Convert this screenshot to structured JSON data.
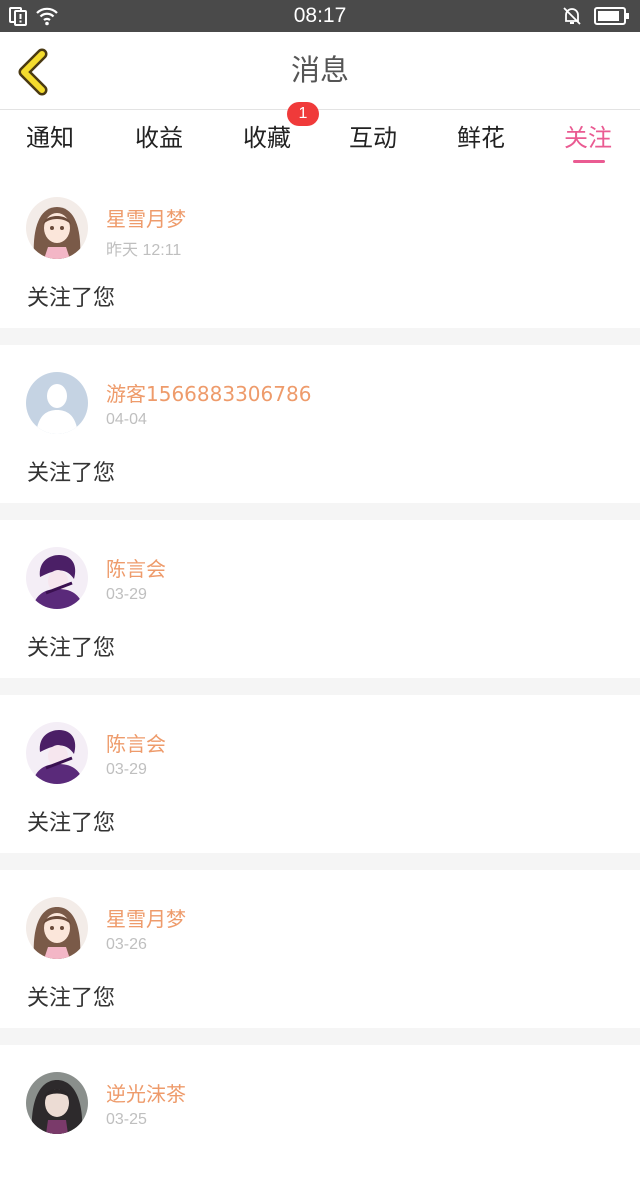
{
  "status_bar": {
    "time": "08:17",
    "icons": [
      "sim-alert-icon",
      "wifi-icon",
      "bell-off-icon",
      "battery-icon"
    ]
  },
  "nav": {
    "back_icon": "chevron-left-icon",
    "title": "消息"
  },
  "tabs": {
    "items": [
      {
        "label": "通知"
      },
      {
        "label": "收益"
      },
      {
        "label": "收藏",
        "badge": "1"
      },
      {
        "label": "互动"
      },
      {
        "label": "鲜花"
      },
      {
        "label": "关注",
        "active": true
      }
    ]
  },
  "colors": {
    "accent": "#ea5b92",
    "username": "#ee9b6b",
    "badge": "#f03a3a"
  },
  "messages": [
    {
      "name": "星雪月梦",
      "date": "昨天 12:11",
      "text": "关注了您",
      "avatar": "girl-avatar"
    },
    {
      "name": "游客1566883306786",
      "date": "04-04",
      "text": "关注了您",
      "avatar": "default-user-avatar"
    },
    {
      "name": "陈言会",
      "date": "03-29",
      "text": "关注了您",
      "avatar": "purple-boy-avatar"
    },
    {
      "name": "陈言会",
      "date": "03-29",
      "text": "关注了您",
      "avatar": "purple-boy-avatar"
    },
    {
      "name": "星雪月梦",
      "date": "03-26",
      "text": "关注了您",
      "avatar": "girl-avatar"
    },
    {
      "name": "逆光沫茶",
      "date": "03-25",
      "text": "",
      "avatar": "dark-girl-avatar"
    }
  ]
}
